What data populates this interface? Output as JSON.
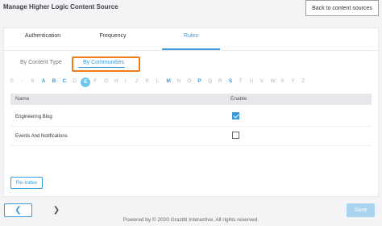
{
  "header": {
    "title": "Manage Higher Logic Content Source",
    "back_label": "Back to content sources"
  },
  "tabs": [
    {
      "label": "Authentication"
    },
    {
      "label": "Frequency"
    },
    {
      "label": "Rules",
      "active": true
    }
  ],
  "subtabs": {
    "content_type": "By Content Type",
    "communities": "By Communities"
  },
  "alphabet": {
    "letters": [
      "0",
      "-",
      "9",
      "A",
      "B",
      "C",
      "D",
      "E",
      "F",
      "G",
      "H",
      "I",
      "J",
      "K",
      "L",
      "M",
      "N",
      "O",
      "P",
      "Q",
      "R",
      "S",
      "T",
      "U",
      "V",
      "W",
      "X",
      "Y",
      "Z"
    ],
    "selected": "E",
    "emphasized": [
      "A",
      "B",
      "C",
      "M",
      "P",
      "S"
    ]
  },
  "table": {
    "headers": {
      "name": "Name",
      "enable": "Enable"
    },
    "rows": [
      {
        "name": "Engineering Blog",
        "enabled": true
      },
      {
        "name": "Events And Notifications",
        "enabled": false
      }
    ]
  },
  "buttons": {
    "reindex": "Re-Index",
    "save": "Save",
    "prev_icon": "chevron-left-icon",
    "next_icon": "chevron-right-icon"
  },
  "footer": {
    "text": "Powered by © 2020 Grazitti Interactive. All rights reserved."
  },
  "colors": {
    "accent": "#3a9ad9",
    "highlight": "#f07d1a",
    "save_disabled": "#a9d3ee"
  }
}
